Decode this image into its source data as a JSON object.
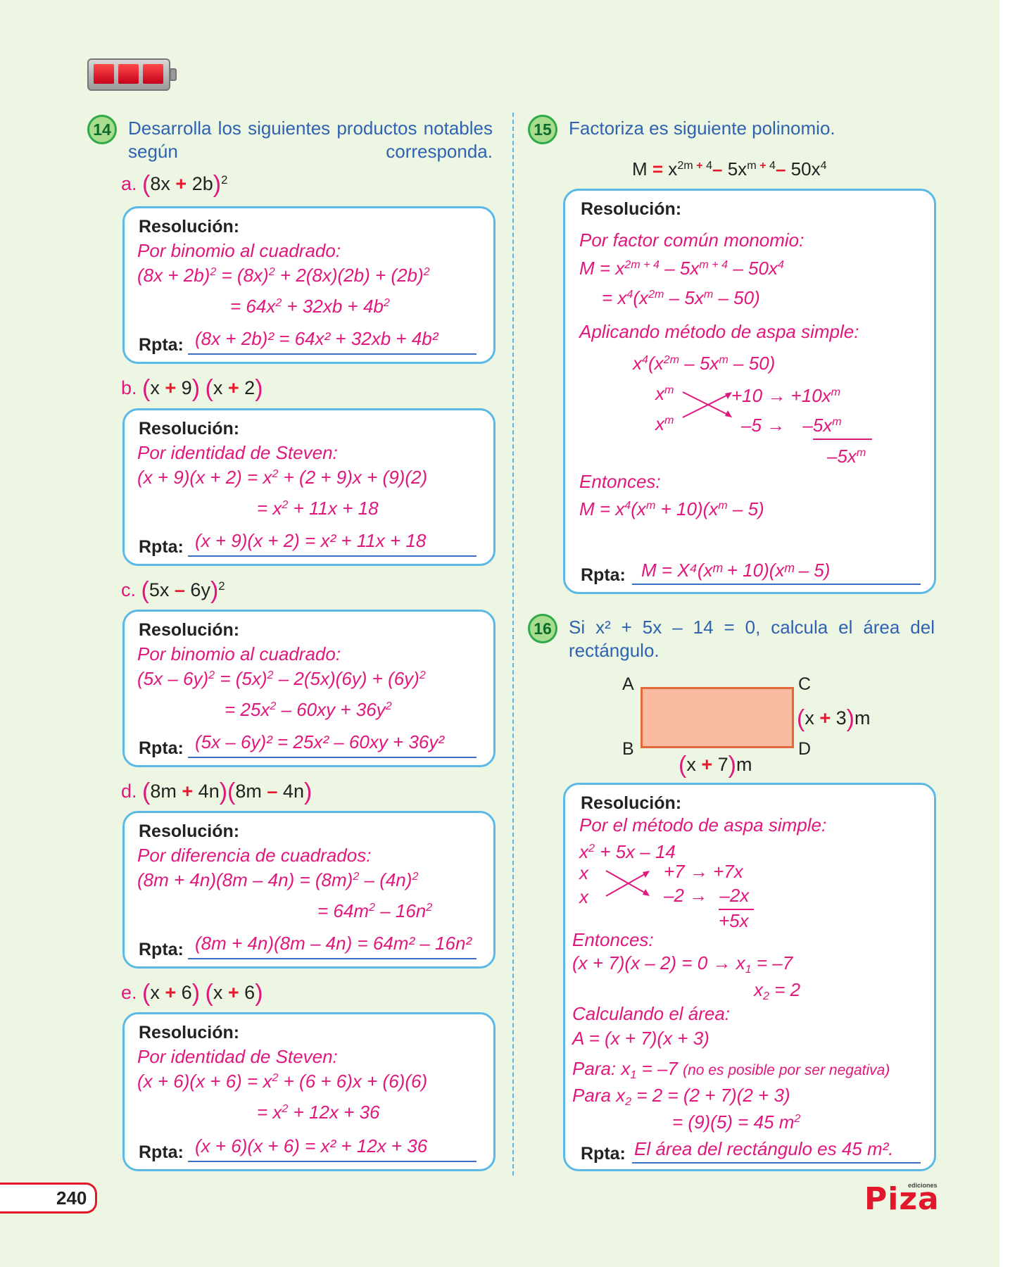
{
  "page_number": "240",
  "logo": {
    "small": "ediciones",
    "big": "Piza"
  },
  "q14": {
    "number": "14",
    "text": "Desarrolla los siguientes productos notables según corresponda.",
    "res_label": "Resolución:",
    "rpta_label": "Rpta:",
    "items": [
      {
        "letter": "a.",
        "method": "Por binomio al cuadrado:",
        "answer": "(8x + 2b)² = 64x² + 32xb + 4b²"
      },
      {
        "letter": "b.",
        "method": "Por identidad de Steven:",
        "answer": "(x + 9)(x + 2) = x² + 11x + 18"
      },
      {
        "letter": "c.",
        "method": "Por binomio al cuadrado:",
        "answer": "(5x – 6y)² = 25x² – 60xy + 36y²"
      },
      {
        "letter": "d.",
        "method": "Por diferencia de cuadrados:",
        "answer": "(8m + 4n)(8m – 4n) = 64m² – 16n²"
      },
      {
        "letter": "e.",
        "method": "Por identidad de Steven:",
        "answer": "(x + 6)(x + 6) = x² + 12x + 36"
      }
    ]
  },
  "q15": {
    "number": "15",
    "text": "Factoriza es siguiente polinomio.",
    "res_label": "Resolución:",
    "method1": "Por factor común monomio:",
    "method2": "Aplicando método de aspa simple:",
    "then": "Entonces:",
    "rpta_label": "Rpta:",
    "answer": "M = X⁴(xᵐ + 10)(xᵐ – 5)"
  },
  "q16": {
    "number": "16",
    "text": "Si x² + 5x – 14 = 0, calcula el área del rectángulo.",
    "vertices": {
      "a": "A",
      "b": "B",
      "c": "C",
      "d": "D"
    },
    "res_label": "Resolución:",
    "method": "Por el método de aspa simple:",
    "then": "Entonces:",
    "calc": "Calculando el área:",
    "note": "(no es posible por ser negativa)",
    "rpta_label": "Rpta:",
    "answer": "El área del rectángulo es 45 m²."
  }
}
